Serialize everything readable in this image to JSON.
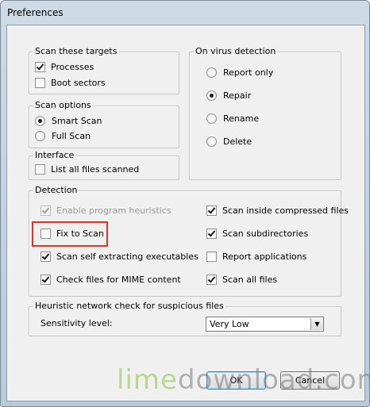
{
  "window": {
    "title": "Preferences"
  },
  "scan_targets": {
    "legend": "Scan these targets",
    "items": [
      {
        "label": "Processes",
        "checked": true
      },
      {
        "label": "Boot sectors",
        "checked": false
      }
    ]
  },
  "scan_options": {
    "legend": "Scan options",
    "items": [
      {
        "label": "Smart Scan",
        "selected": true
      },
      {
        "label": "Full Scan",
        "selected": false
      }
    ]
  },
  "interface": {
    "legend": "Interface",
    "items": [
      {
        "label": "List all files scanned",
        "checked": false
      }
    ]
  },
  "on_virus_detection": {
    "legend": "On virus detection",
    "items": [
      {
        "label": "Report only",
        "selected": false
      },
      {
        "label": "Repair",
        "selected": true
      },
      {
        "label": "Rename",
        "selected": false
      },
      {
        "label": "Delete",
        "selected": false
      }
    ]
  },
  "detection": {
    "legend": "Detection",
    "left": [
      {
        "label": "Enable program heuristics",
        "checked": true,
        "disabled": true
      },
      {
        "label": "Fix to Scan",
        "checked": false,
        "highlighted": true
      },
      {
        "label": "Scan self extracting executables",
        "checked": true
      },
      {
        "label": "Check files for MIME content",
        "checked": true
      }
    ],
    "right": [
      {
        "label": "Scan inside compressed files",
        "checked": true
      },
      {
        "label": "Scan subdirectories",
        "checked": true
      },
      {
        "label": "Report applications",
        "checked": false
      },
      {
        "label": "Scan all files",
        "checked": true
      }
    ]
  },
  "heuristic": {
    "legend": "Heuristic network check for suspicious files",
    "sensitivity_label": "Sensitivity level:",
    "sensitivity_value": "Very Low"
  },
  "buttons": {
    "ok": "OK",
    "cancel": "Cancel"
  },
  "watermark": {
    "part1": "lime",
    "part2": "download.com"
  },
  "colors": {
    "highlight": "#d9332b",
    "watermark_green": "#8dc63f"
  }
}
